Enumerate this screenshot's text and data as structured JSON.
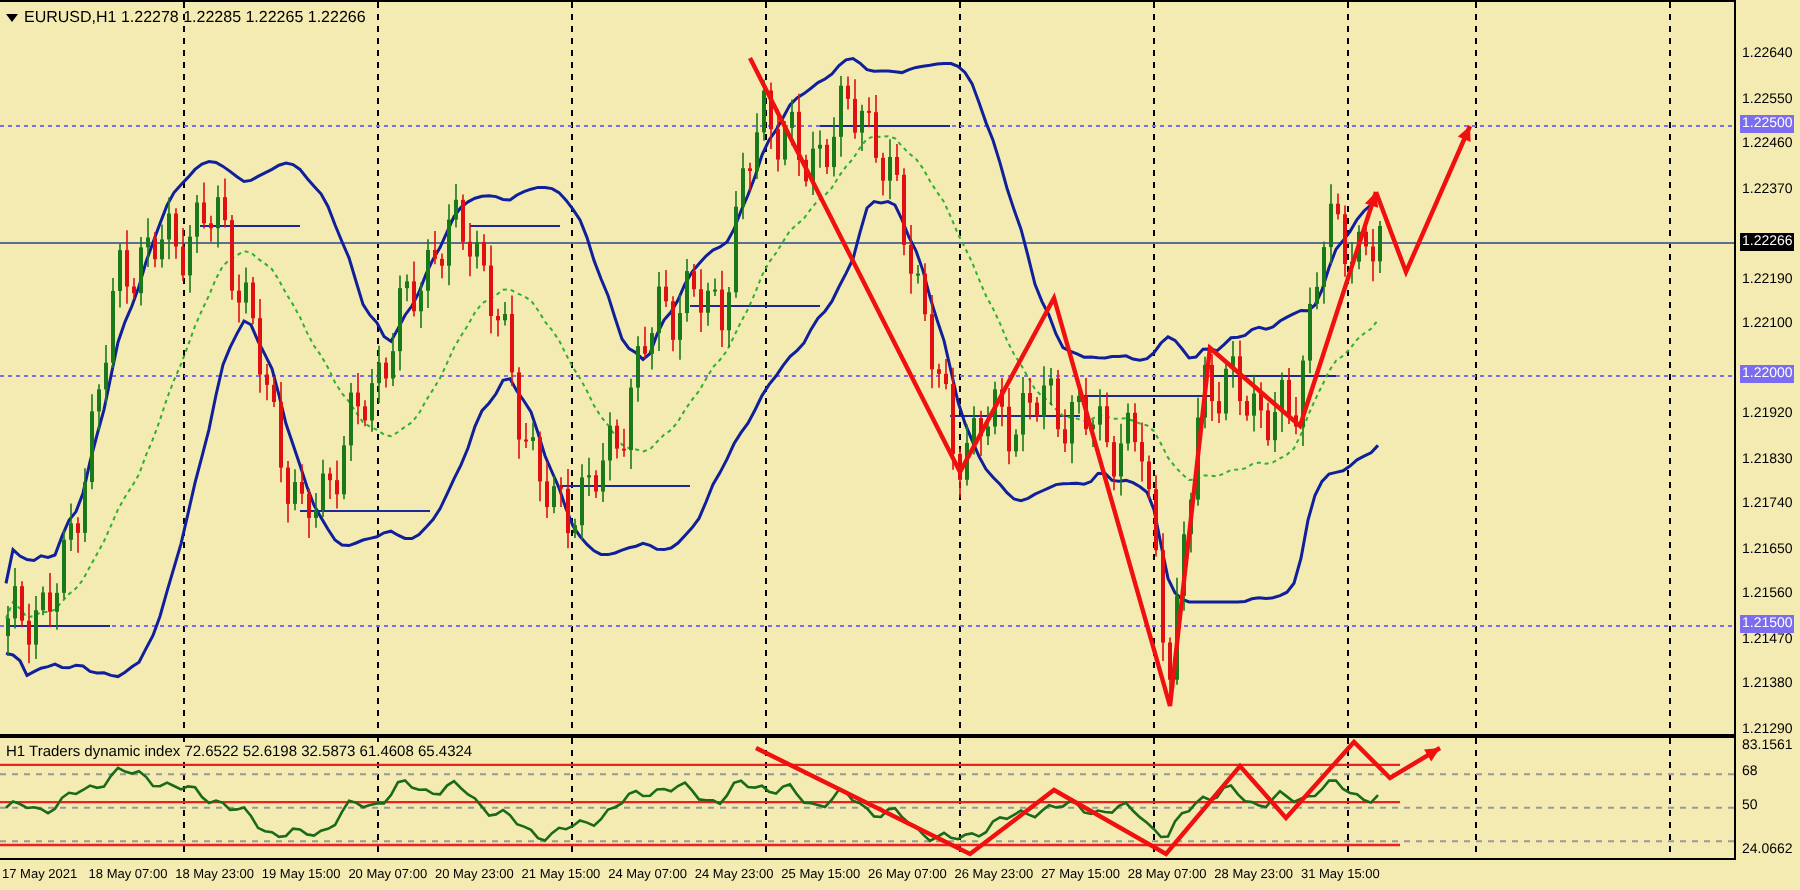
{
  "chart": {
    "title": "EURUSD,H1  1.22278 1.22285 1.22265 1.22266"
  },
  "price_axis": [
    {
      "label": "1.22640",
      "kind": "tick"
    },
    {
      "label": "1.22550",
      "kind": "tick"
    },
    {
      "label": "1.22500",
      "kind": "level"
    },
    {
      "label": "1.22460",
      "kind": "tick"
    },
    {
      "label": "1.22370",
      "kind": "tick"
    },
    {
      "label": "1.22266",
      "kind": "current"
    },
    {
      "label": "1.22190",
      "kind": "tick"
    },
    {
      "label": "1.22100",
      "kind": "tick"
    },
    {
      "label": "1.22000",
      "kind": "level"
    },
    {
      "label": "1.21920",
      "kind": "tick"
    },
    {
      "label": "1.21830",
      "kind": "tick"
    },
    {
      "label": "1.21740",
      "kind": "tick"
    },
    {
      "label": "1.21650",
      "kind": "tick"
    },
    {
      "label": "1.21560",
      "kind": "tick"
    },
    {
      "label": "1.21500",
      "kind": "level"
    },
    {
      "label": "1.21470",
      "kind": "tick"
    },
    {
      "label": "1.21380",
      "kind": "tick"
    },
    {
      "label": "1.21290",
      "kind": "tick"
    }
  ],
  "indicator": {
    "title": "H1 Traders dynamic index 72.6522 52.6198 32.5873 61.4608 65.4324",
    "axis": [
      {
        "label": "83.1561"
      },
      {
        "label": "68"
      },
      {
        "label": "50"
      },
      {
        "label": "24.0662"
      }
    ]
  },
  "time_axis": [
    "17 May 2021",
    "18 May 07:00",
    "18 May 23:00",
    "19 May 15:00",
    "20 May 07:00",
    "20 May 23:00",
    "21 May 15:00",
    "24 May 07:00",
    "24 May 23:00",
    "25 May 15:00",
    "26 May 07:00",
    "26 May 23:00",
    "27 May 15:00",
    "28 May 07:00",
    "28 May 23:00",
    "31 May 15:00"
  ]
}
